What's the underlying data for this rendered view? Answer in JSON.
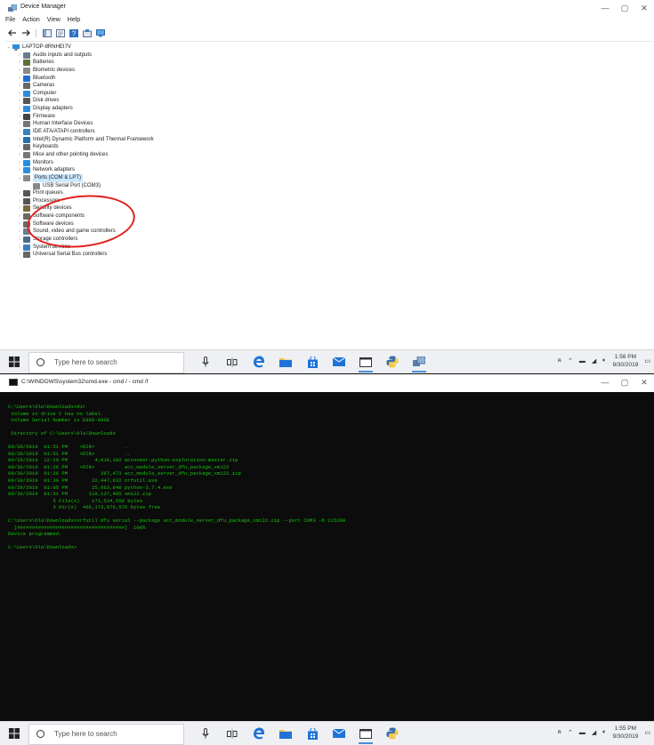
{
  "device_manager": {
    "title": "Device Manager",
    "menu": [
      "File",
      "Action",
      "View",
      "Help"
    ],
    "toolbar": {
      "back": "←",
      "forward": "→",
      "props": "▦",
      "help": "?"
    },
    "tree": {
      "root": "LAPTOP-8RNHEI7V",
      "items": [
        {
          "label": "Audio inputs and outputs",
          "icon": "speaker-icon",
          "color": "#6b7b8c"
        },
        {
          "label": "Batteries",
          "icon": "battery-icon",
          "color": "#5f6f3a"
        },
        {
          "label": "Biometric devices",
          "icon": "fingerprint-icon",
          "color": "#8a8a8a"
        },
        {
          "label": "Bluetooth",
          "icon": "bluetooth-icon",
          "color": "#1d6fd0"
        },
        {
          "label": "Cameras",
          "icon": "camera-icon",
          "color": "#666666"
        },
        {
          "label": "Computer",
          "icon": "computer-icon",
          "color": "#2a8ee0"
        },
        {
          "label": "Disk drives",
          "icon": "disk-icon",
          "color": "#555555"
        },
        {
          "label": "Display adapters",
          "icon": "display-icon",
          "color": "#2a8ee0"
        },
        {
          "label": "Firmware",
          "icon": "chip-icon",
          "color": "#444444"
        },
        {
          "label": "Human Interface Devices",
          "icon": "hid-icon",
          "color": "#777777"
        },
        {
          "label": "IDE ATA/ATAPI controllers",
          "icon": "ide-icon",
          "color": "#3a7fc0"
        },
        {
          "label": "Intel(R) Dynamic Platform and Thermal Framework",
          "icon": "thermal-icon",
          "color": "#2a6fb0"
        },
        {
          "label": "Keyboards",
          "icon": "keyboard-icon",
          "color": "#666666"
        },
        {
          "label": "Mice and other pointing devices",
          "icon": "mouse-icon",
          "color": "#777777"
        },
        {
          "label": "Monitors",
          "icon": "monitor-icon",
          "color": "#2a8ee0"
        },
        {
          "label": "Network adapters",
          "icon": "network-icon",
          "color": "#2a8ee0"
        },
        {
          "label": "Ports (COM & LPT)",
          "icon": "port-icon",
          "color": "#888888",
          "expanded": true,
          "highlight": true
        },
        {
          "label": "USB Serial Port (COM3)",
          "icon": "port-icon",
          "color": "#888888",
          "child": true
        },
        {
          "label": "Print queues",
          "icon": "printer-icon",
          "color": "#555555"
        },
        {
          "label": "Processors",
          "icon": "processor-icon",
          "color": "#555555"
        },
        {
          "label": "Security devices",
          "icon": "security-icon",
          "color": "#7a6a3a"
        },
        {
          "label": "Software components",
          "icon": "component-icon",
          "color": "#6a6a6a"
        },
        {
          "label": "Software devices",
          "icon": "software-icon",
          "color": "#6a6a6a"
        },
        {
          "label": "Sound, video and game controllers",
          "icon": "speaker-icon",
          "color": "#6b7b8c"
        },
        {
          "label": "Storage controllers",
          "icon": "storage-icon",
          "color": "#4a6a8a"
        },
        {
          "label": "System devices",
          "icon": "system-icon",
          "color": "#3a7fc0"
        },
        {
          "label": "Universal Serial Bus controllers",
          "icon": "usb-icon",
          "color": "#666666"
        }
      ]
    }
  },
  "taskbar_top": {
    "search_placeholder": "Type here to search",
    "time": "1:56 PM",
    "date": "9/30/2019"
  },
  "cmd": {
    "title": "C:\\WINDOWS\\system32\\cmd.exe - cmd  / - cmd  /f",
    "lines": [
      "C:\\Users\\Ola\\Downloads>dir",
      " Volume in drive C has no label.",
      " Volume Serial Number is E889-896E",
      "",
      " Directory of C:\\Users\\Ola\\Downloads",
      "",
      "09/30/2019  01:51 PM    <DIR>          .",
      "09/30/2019  01:51 PM    <DIR>          ..",
      "09/29/2019  12:29 PM         4,018,102 acconeer-python-exploration-master.zip",
      "09/30/2019  01:26 PM    <DIR>          acc_module_server_dfu_package_xm122",
      "09/30/2019  01:26 PM           267,473 acc_module_server_dfu_package_xm122.zip",
      "09/30/2019  01:30 PM        22,447,632 nrfutil.exe",
      "09/29/2019  01:05 PM        25,663,848 python-3.7.4.exe",
      "09/30/2019  01:51 PM       119,137,495 xm122.zip",
      "               5 File(s)    171,534,550 bytes",
      "               3 Dir(s)  466,173,976,576 bytes free",
      "",
      "C:\\Users\\Ola\\Downloads>nrfutil dfu serial --package acc_module_server_dfu_package_xm122.zip --port COM3 -b 115200",
      "  [####################################]  100%",
      "Device programmed.",
      "",
      "C:\\Users\\Ola\\Downloads>"
    ]
  },
  "taskbar_bottom": {
    "search_placeholder": "Type here to search",
    "time": "1:55 PM",
    "date": "9/30/2019"
  },
  "colors": {
    "console_text": "#16c60c",
    "console_bg": "#0c0c0c",
    "annotation": "#e0201b",
    "highlight": "#cce8ff"
  }
}
